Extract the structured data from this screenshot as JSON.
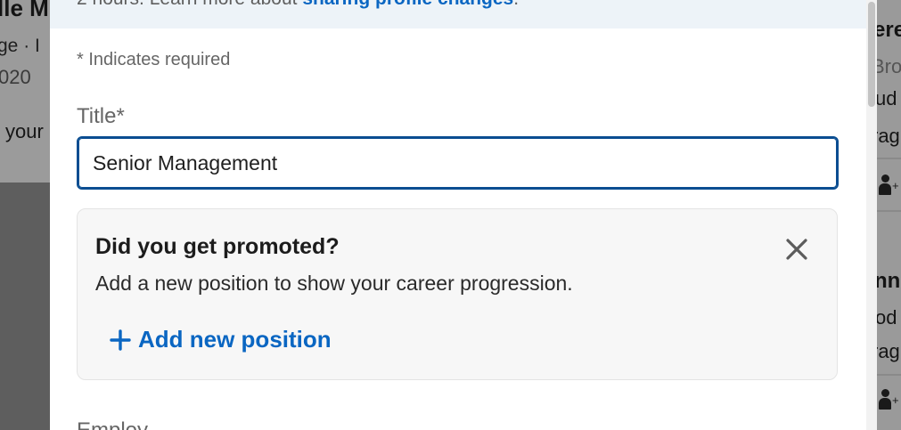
{
  "background": {
    "left": {
      "name": "lle M",
      "subtitle": "ge · I",
      "date": "020",
      "body": "your"
    },
    "right": {
      "lines": [
        "ere",
        "Bro",
        "ud",
        "rag",
        "nn",
        "od",
        "rag"
      ]
    }
  },
  "modal": {
    "notice": {
      "text": "2 hours. Learn more about ",
      "link": "sharing profile changes",
      "trailing": "."
    },
    "required_note": "* Indicates required",
    "title_field": {
      "label": "Title*",
      "value": "Senior Management"
    },
    "promo_card": {
      "title": "Did you get promoted?",
      "description": "Add a new position to show your career progression.",
      "action_label": "Add new position",
      "close_icon": "close-icon"
    },
    "next_field_label": "Employ"
  },
  "colors": {
    "accent": "#0a66c2",
    "input_border": "#0a4d91",
    "notice_bg": "#edf3f8"
  }
}
